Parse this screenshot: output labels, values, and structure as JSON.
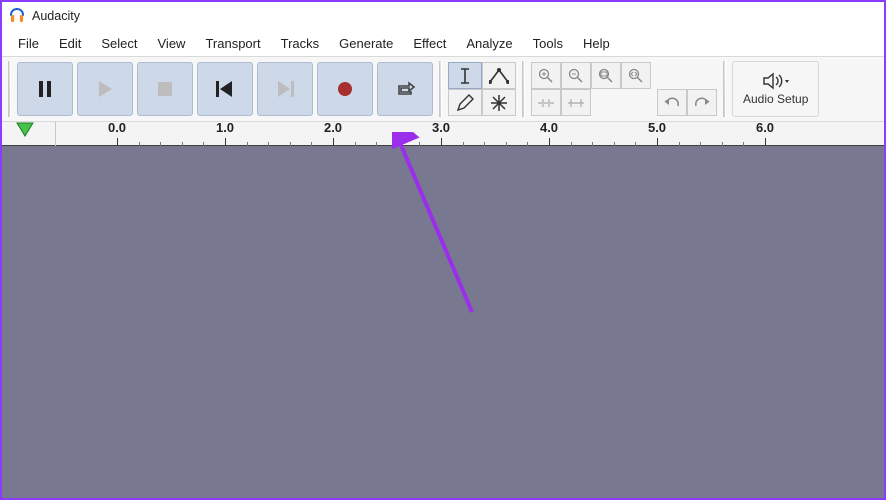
{
  "app": {
    "title": "Audacity"
  },
  "menu": {
    "items": [
      {
        "label": "File"
      },
      {
        "label": "Edit"
      },
      {
        "label": "Select"
      },
      {
        "label": "View"
      },
      {
        "label": "Transport"
      },
      {
        "label": "Tracks"
      },
      {
        "label": "Generate"
      },
      {
        "label": "Effect"
      },
      {
        "label": "Analyze"
      },
      {
        "label": "Tools"
      },
      {
        "label": "Help"
      }
    ]
  },
  "transport": {
    "buttons": [
      {
        "name": "pause"
      },
      {
        "name": "play"
      },
      {
        "name": "stop"
      },
      {
        "name": "skip-start"
      },
      {
        "name": "skip-end"
      },
      {
        "name": "record"
      },
      {
        "name": "loop"
      }
    ]
  },
  "tools": {
    "items": [
      {
        "name": "selection",
        "selected": true
      },
      {
        "name": "envelope",
        "selected": false
      },
      {
        "name": "draw",
        "selected": false
      },
      {
        "name": "multi",
        "selected": false
      }
    ]
  },
  "zoom": {
    "items": [
      {
        "name": "zoom-in"
      },
      {
        "name": "zoom-out"
      },
      {
        "name": "fit-selection"
      },
      {
        "name": "fit-project"
      },
      {
        "name": "zoom-toggle"
      },
      {
        "name": "trim"
      },
      {
        "name": "undo"
      },
      {
        "name": "redo"
      }
    ]
  },
  "audio_setup": {
    "label": "Audio Setup"
  },
  "ruler": {
    "ticks": [
      "0.0",
      "1.0",
      "2.0",
      "3.0",
      "4.0",
      "5.0",
      "6.0"
    ]
  },
  "annotation": {
    "color": "#9a2eeb"
  }
}
